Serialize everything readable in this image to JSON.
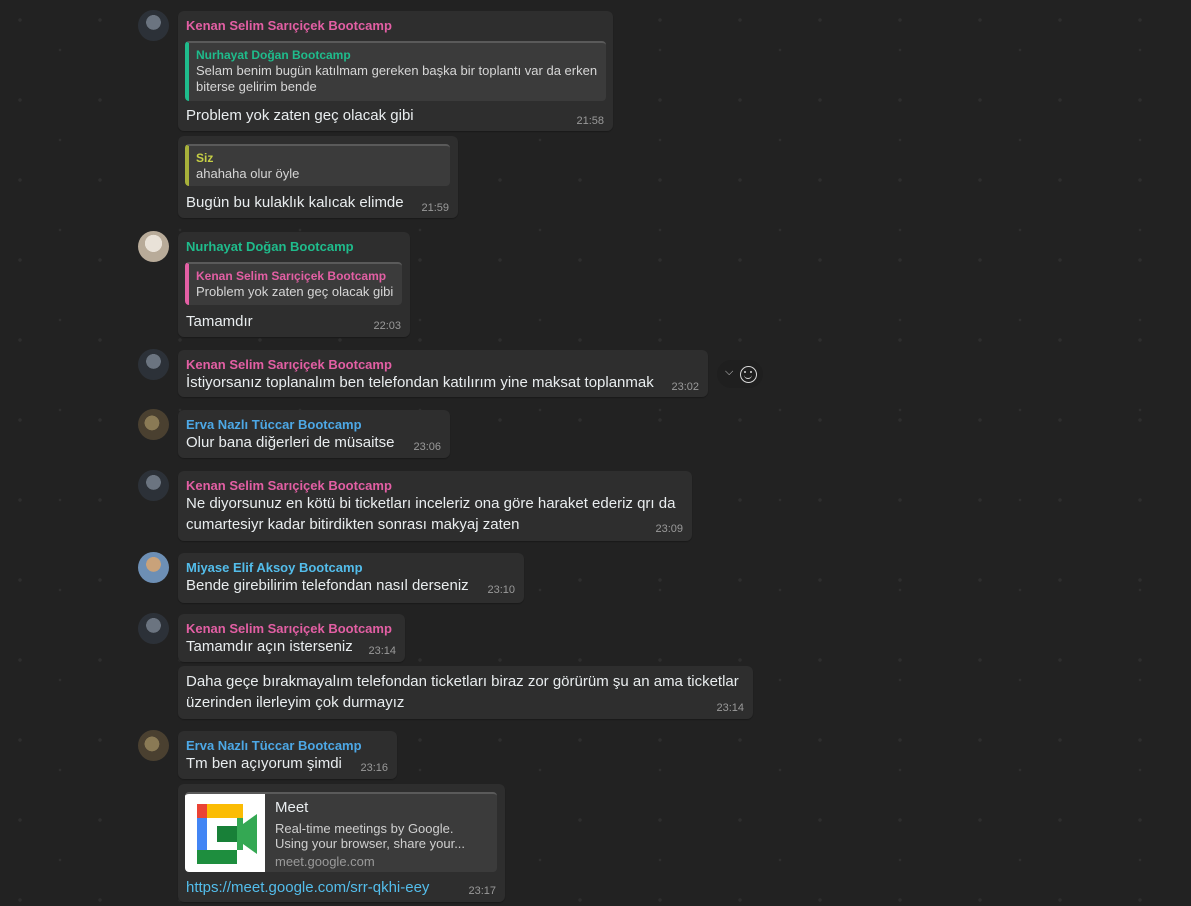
{
  "messages": [
    {
      "sender": "Kenan Selim Sarıçiçek Bootcamp",
      "quote_name": "Nurhayat Doğan Bootcamp",
      "quote_text": "Selam benim bugün katılmam gereken başka bir toplantı var da erken biterse gelirim bende",
      "text": "Problem yok zaten geç olacak gibi",
      "time": "21:58"
    },
    {
      "quote_name": "Siz",
      "quote_text": "ahahaha olur öyle",
      "text": "Bugün bu kulaklık kalıcak elimde",
      "time": "21:59"
    },
    {
      "sender": "Nurhayat Doğan Bootcamp",
      "quote_name": "Kenan Selim Sarıçiçek Bootcamp",
      "quote_text": "Problem yok zaten geç olacak gibi",
      "text": "Tamamdır",
      "time": "22:03"
    },
    {
      "sender": "Kenan Selim Sarıçiçek Bootcamp",
      "text": "İstiyorsanız toplanalım ben telefondan katılırım yine maksat toplanmak",
      "time": "23:02"
    },
    {
      "sender": "Erva Nazlı Tüccar Bootcamp",
      "text": "Olur bana diğerleri de müsaitse",
      "time": "23:06"
    },
    {
      "sender": "Kenan Selim Sarıçiçek Bootcamp",
      "text_line1": "Ne diyorsunuz en kötü bi ticketları inceleriz ona göre haraket ederiz qrı da",
      "text_line2": "cumartesiyr kadar bitirdikten sonrası makyaj zaten",
      "time": "23:09"
    },
    {
      "sender": "Miyase Elif Aksoy Bootcamp",
      "text": "Bende girebilirim telefondan nasıl derseniz",
      "time": "23:10"
    },
    {
      "sender": "Kenan Selim Sarıçiçek Bootcamp",
      "text": "Tamamdır açın isterseniz",
      "time": "23:14"
    },
    {
      "text_line1": "Daha geçe bırakmayalım telefondan ticketları biraz zor görürüm şu an ama ticketlar",
      "text_line2": "üzerinden ilerleyim çok durmayız",
      "time": "23:14"
    },
    {
      "sender": "Erva Nazlı Tüccar Bootcamp",
      "text": "Tm ben açıyorum şimdi",
      "time": "23:16"
    },
    {
      "preview_title": "Meet",
      "preview_desc": "Real-time meetings by Google. Using your browser, share your...",
      "preview_domain": "meet.google.com",
      "link": "https://meet.google.com/srr-qkhi-eey",
      "time": "23:17"
    }
  ],
  "icons": {
    "menu": "chevron-down-icon",
    "react": "emoji-smile-icon"
  },
  "colors": {
    "background": "#222222",
    "bubble": "#2e2e2e",
    "kenan": "#e35fa4",
    "nurhayat": "#1fbc8c",
    "erva": "#4da8e6",
    "miyase": "#53bdeb",
    "self": "#c6cf45",
    "link": "#53bdeb"
  }
}
